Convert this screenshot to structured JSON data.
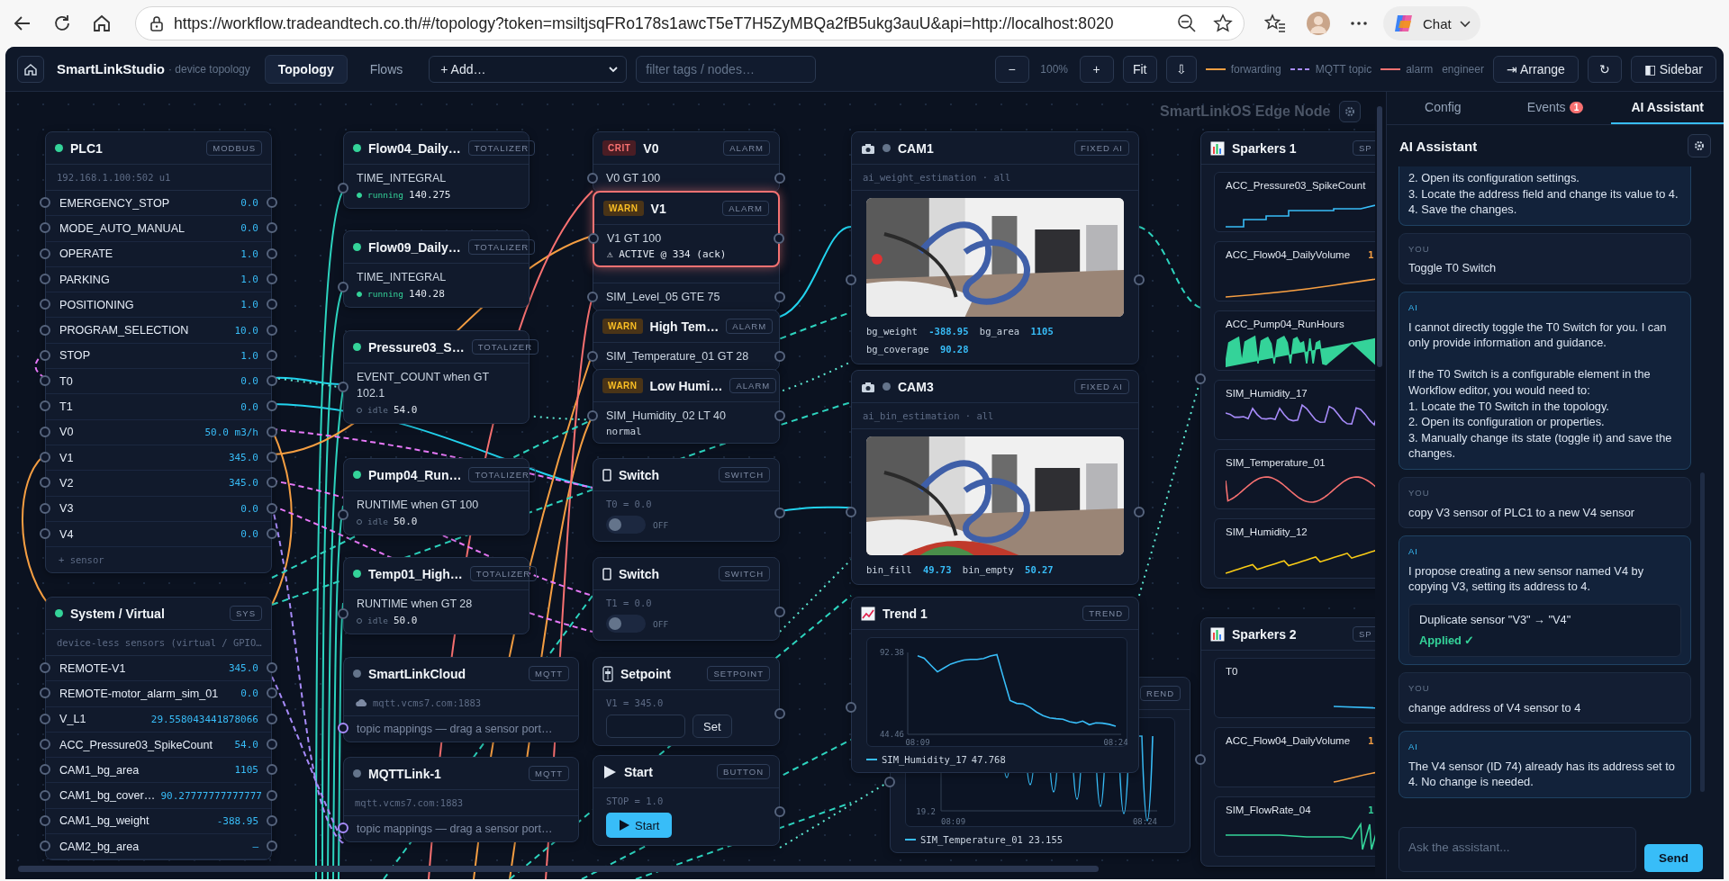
{
  "browser": {
    "url": "https://workflow.tradeandtech.co.th/#/topology?token=msiltjsqFRo178s1awcT5eT7H5ZyMBQa2fB5ukg3auU&api=http://localhost:8020",
    "chat": "Chat"
  },
  "app": {
    "title": "SmartLinkStudio",
    "subtitle": "· device topology"
  },
  "toolbar": {
    "tabs": [
      {
        "label": "Topology",
        "selected": true
      },
      {
        "label": "Flows",
        "selected": false
      }
    ],
    "add_menu": "+ Add…",
    "filter": {
      "placeholder": "filter tags / nodes…"
    },
    "zoom_out": "−",
    "zoom_level": "100%",
    "zoom_in": "+",
    "fit": "Fit",
    "download": "⇩",
    "legend": [
      {
        "label": "forwarding",
        "kind": "solid",
        "color": "#f59e42"
      },
      {
        "label": "MQTT topic",
        "kind": "dashed",
        "color": "#a78bfa"
      },
      {
        "label": "alarm",
        "kind": "solid",
        "color": "#f87171"
      }
    ],
    "role": "engineer",
    "arrange": "⇥ Arrange",
    "refresh": "↻",
    "sidebar": "◧ Sidebar"
  },
  "canvas": {
    "edge_node": "SmartLinkOS Edge Node",
    "devices": [
      {
        "title": "PLC1",
        "badge": "MODBUS",
        "online": true,
        "address": "192.168.1.100:502 u1",
        "sensors": [
          {
            "name": "EMERGENCY_STOP",
            "value": "0.0"
          },
          {
            "name": "MODE_AUTO_MANUAL",
            "value": "0.0"
          },
          {
            "name": "OPERATE",
            "value": "1.0"
          },
          {
            "name": "PARKING",
            "value": "1.0"
          },
          {
            "name": "POSITIONING",
            "value": "1.0"
          },
          {
            "name": "PROGRAM_SELECTION",
            "value": "10.0"
          },
          {
            "name": "STOP",
            "value": "1.0"
          },
          {
            "name": "T0",
            "value": "0.0"
          },
          {
            "name": "T1",
            "value": "0.0"
          },
          {
            "name": "V0",
            "value": "50.0 m3/h"
          },
          {
            "name": "V1",
            "value": "345.0"
          },
          {
            "name": "V2",
            "value": "345.0"
          },
          {
            "name": "V3",
            "value": "0.0"
          },
          {
            "name": "V4",
            "value": "0.0"
          }
        ],
        "add_label": "+ sensor"
      },
      {
        "title": "System / Virtual",
        "badge": "SYS",
        "online": true,
        "address": "device-less sensors (virtual / GPIO…",
        "sensors": [
          {
            "name": "REMOTE-V1",
            "value": "345.0"
          },
          {
            "name": "REMOTE-motor_alarm_sim_01",
            "value": "0.0"
          },
          {
            "name": "V_L1",
            "value": "29.558043441878066"
          },
          {
            "name": "ACC_Pressure03_SpikeCount",
            "value": "54.0"
          },
          {
            "name": "CAM1_bg_area",
            "value": "1105"
          },
          {
            "name": "CAM1_bg_cover…",
            "value": "90.27777777777777"
          },
          {
            "name": "CAM1_bg_weight",
            "value": "-388.95"
          },
          {
            "name": "CAM2_bg_area",
            "value": "–"
          }
        ]
      }
    ],
    "totalizers": [
      {
        "title": "Flow04_Daily…",
        "badge": "TOTALIZER",
        "online": true,
        "mode": "TIME_INTEGRAL",
        "running": true,
        "status": "running",
        "value": "140.275"
      },
      {
        "title": "Flow09_Daily…",
        "badge": "TOTALIZER",
        "online": true,
        "mode": "TIME_INTEGRAL",
        "running": true,
        "status": "running",
        "value": "140.28"
      },
      {
        "title": "Pressure03_S…",
        "badge": "TOTALIZER",
        "online": true,
        "mode": "EVENT_COUNT when GT 102.1",
        "running": false,
        "status": "idle",
        "value": "54.0"
      },
      {
        "title": "Pump04_Run…",
        "badge": "TOTALIZER",
        "online": true,
        "mode": "RUNTIME when GT 100",
        "running": false,
        "status": "idle",
        "value": "50.0"
      },
      {
        "title": "Temp01_High…",
        "badge": "TOTALIZER",
        "online": true,
        "mode": "RUNTIME when GT 28",
        "running": false,
        "status": "idle",
        "value": "50.0"
      }
    ],
    "mqtt": [
      {
        "title": "SmartLinkCloud",
        "badge": "MQTT",
        "online": false,
        "cloud": true,
        "host": "mqtt.vcms7.com:1883",
        "mappings": "topic mappings — drag a sensor port…"
      },
      {
        "title": "MQTTLink-1",
        "badge": "MQTT",
        "online": false,
        "cloud": false,
        "host": "mqtt.vcms7.com:1883",
        "mappings": "topic mappings — drag a sensor port…"
      }
    ],
    "alarms": [
      {
        "severity": "CRIT",
        "kind": "crit",
        "title": "V0",
        "badge": "ALARM",
        "condition": "V0 GT 100",
        "active": false
      },
      {
        "severity": "WARN",
        "kind": "warn",
        "title": "V1",
        "badge": "ALARM",
        "condition": "V1 GT 100",
        "active": true,
        "status": "⚠ ACTIVE @ 334 (ack)"
      },
      {
        "condition": "SIM_Level_05 GTE 75",
        "active": false
      },
      {
        "severity": "WARN",
        "kind": "warn",
        "title": "High Tem…",
        "badge": "ALARM",
        "condition": "SIM_Temperature_01 GT 28",
        "active": false
      },
      {
        "severity": "WARN",
        "kind": "warn",
        "title": "Low Humi…",
        "badge": "ALARM",
        "condition": "SIM_Humidity_02 LT 40",
        "active": false,
        "status": "normal"
      }
    ],
    "controls": [
      {
        "kind": "switch",
        "title": "Switch",
        "badge": "SWITCH",
        "binding": "T0 = 0.0",
        "on": false,
        "state_label": "OFF"
      },
      {
        "kind": "switch",
        "title": "Switch",
        "badge": "SWITCH",
        "binding": "T1 = 0.0",
        "on": false,
        "state_label": "OFF"
      },
      {
        "kind": "setpoint",
        "title": "Setpoint",
        "badge": "SETPOINT",
        "binding": "V1 = 345.0",
        "button": "Set"
      },
      {
        "kind": "button",
        "title": "Start",
        "badge": "BUTTON",
        "binding": "STOP = 1.0",
        "button": "Start"
      }
    ],
    "cameras": [
      {
        "title": "CAM1",
        "badge": "FIXED AI",
        "online": false,
        "model": "ai_weight_estimation · all",
        "readings": [
          {
            "name": "bg_weight",
            "value": "-388.95"
          },
          {
            "name": "bg_area",
            "value": "1105"
          },
          {
            "name": "bg_coverage",
            "value": "90.28"
          }
        ]
      },
      {
        "title": "CAM3",
        "badge": "FIXED AI",
        "online": false,
        "model": "ai_bin_estimation · all",
        "readings": [
          {
            "name": "bin_fill",
            "value": "49.73"
          },
          {
            "name": "bin_empty",
            "value": "50.27"
          }
        ]
      }
    ],
    "trends": [
      {
        "title": "Trend 1",
        "badge": "TREND",
        "legend_value": "47.768",
        "chart_data": {
          "type": "line",
          "categories": [
            "08:09",
            null,
            null,
            null,
            null,
            null,
            null,
            null,
            null,
            null,
            null,
            null,
            null,
            null,
            null,
            null,
            null,
            null,
            null,
            null,
            null,
            null,
            null,
            null,
            null,
            null,
            null,
            null,
            null,
            null,
            "08:24"
          ],
          "series": [
            {
              "name": "SIM_Humidity_17",
              "color": "#38bdf8",
              "values": [
                90.4,
                89.0,
                84.9,
                81.0,
                83.3,
                85.6,
                86.8,
                87.9,
                88.3,
                88.3,
                88.8,
                90.3,
                91.1,
                77.6,
                64.2,
                62.6,
                62.2,
                60.3,
                57.5,
                55.4,
                54.1,
                53.6,
                53.3,
                51.8,
                51.1,
                52.2,
                50.1,
                51.2,
                51.0,
                50.3,
                49.2
              ]
            }
          ],
          "ylim": [
            44.46,
            92.38
          ],
          "yticks": [
            44.46,
            92.38
          ]
        }
      },
      {
        "badge": "REND",
        "y_tick": "19.2",
        "x_ticks": [
          "08:09",
          "08:24"
        ],
        "legend": "SIM_Temperature_01 23.155"
      }
    ],
    "sparkers": [
      {
        "title": "Sparkers 1",
        "badge": "SP",
        "items": [
          {
            "label": "ACC_Pressure03_SpikeCount",
            "kind": "step",
            "color": "#38bdf8"
          },
          {
            "label": "ACC_Flow04_DailyVolume",
            "value": "1",
            "kind": "rise",
            "color": "#f59e42"
          },
          {
            "label": "ACC_Pump04_RunHours",
            "kind": "area",
            "color": "#34d399"
          },
          {
            "label": "SIM_Humidity_17",
            "kind": "noise",
            "color": "#a78bfa"
          },
          {
            "label": "SIM_Temperature_01",
            "kind": "wave",
            "color": "#f87171"
          },
          {
            "label": "SIM_Humidity_12",
            "kind": "climb",
            "color": "#facc15"
          }
        ]
      },
      {
        "title": "Sparkers 2",
        "badge": "SP",
        "items": [
          {
            "label": "T0",
            "kind": "flat",
            "color": "#38bdf8"
          },
          {
            "label": "ACC_Flow04_DailyVolume",
            "value": "1",
            "kind": "ramp",
            "color": "#f59e42"
          },
          {
            "label": "SIM_FlowRate_04",
            "value": "1",
            "kind": "saw",
            "color": "#34d399"
          }
        ]
      }
    ]
  },
  "sidebar": {
    "tabs": [
      {
        "label": "Config",
        "selected": false
      },
      {
        "label": "Events",
        "badge": "1",
        "selected": false
      },
      {
        "label": "AI Assistant",
        "selected": true
      }
    ],
    "title": "AI Assistant",
    "messages": [
      {
        "kind": "ai",
        "cut": true,
        "blocks": [
          {
            "kind": "step",
            "text": "2.  Open its configuration settings."
          },
          {
            "kind": "step",
            "text": "3.  Locate the address field and change its value to 4."
          },
          {
            "kind": "step",
            "text": "4.  Save the changes."
          }
        ]
      },
      {
        "kind": "user",
        "role": "YOU",
        "blocks": [
          {
            "kind": "text",
            "text": "Toggle T0 Switch"
          }
        ]
      },
      {
        "kind": "ai",
        "role": "AI",
        "blocks": [
          {
            "kind": "text",
            "text": "I cannot directly toggle the T0 Switch for you. I can only provide information and guidance."
          },
          {
            "kind": "text",
            "text": "If the T0 Switch is a configurable element in the Workflow editor, you would need to:"
          },
          {
            "kind": "step",
            "text": "1.  Locate the T0 Switch in the topology."
          },
          {
            "kind": "step",
            "text": "2.  Open its configuration or properties."
          },
          {
            "kind": "step",
            "text": "3.  Manually change its state (toggle it) and save the changes."
          }
        ]
      },
      {
        "kind": "user",
        "role": "YOU",
        "blocks": [
          {
            "kind": "text",
            "text": "copy V3 sensor of PLC1 to a new V4 sensor"
          }
        ]
      },
      {
        "kind": "ai",
        "role": "AI",
        "blocks": [
          {
            "kind": "text",
            "text": "I propose creating a new sensor named V4 by copying V3, setting its address to 4."
          }
        ],
        "action": {
          "text": "Duplicate sensor \"V3\" → \"V4\"",
          "status": "Applied ✓"
        }
      },
      {
        "kind": "user",
        "role": "YOU",
        "blocks": [
          {
            "kind": "text",
            "text": "change address of V4 sensor to 4"
          }
        ]
      },
      {
        "kind": "ai",
        "role": "AI",
        "blocks": [
          {
            "kind": "text",
            "text": "The V4 sensor (ID 74) already has its address set to 4. No change is needed."
          }
        ]
      }
    ],
    "input": {
      "placeholder": "Ask the assistant..."
    },
    "send": "Send"
  }
}
